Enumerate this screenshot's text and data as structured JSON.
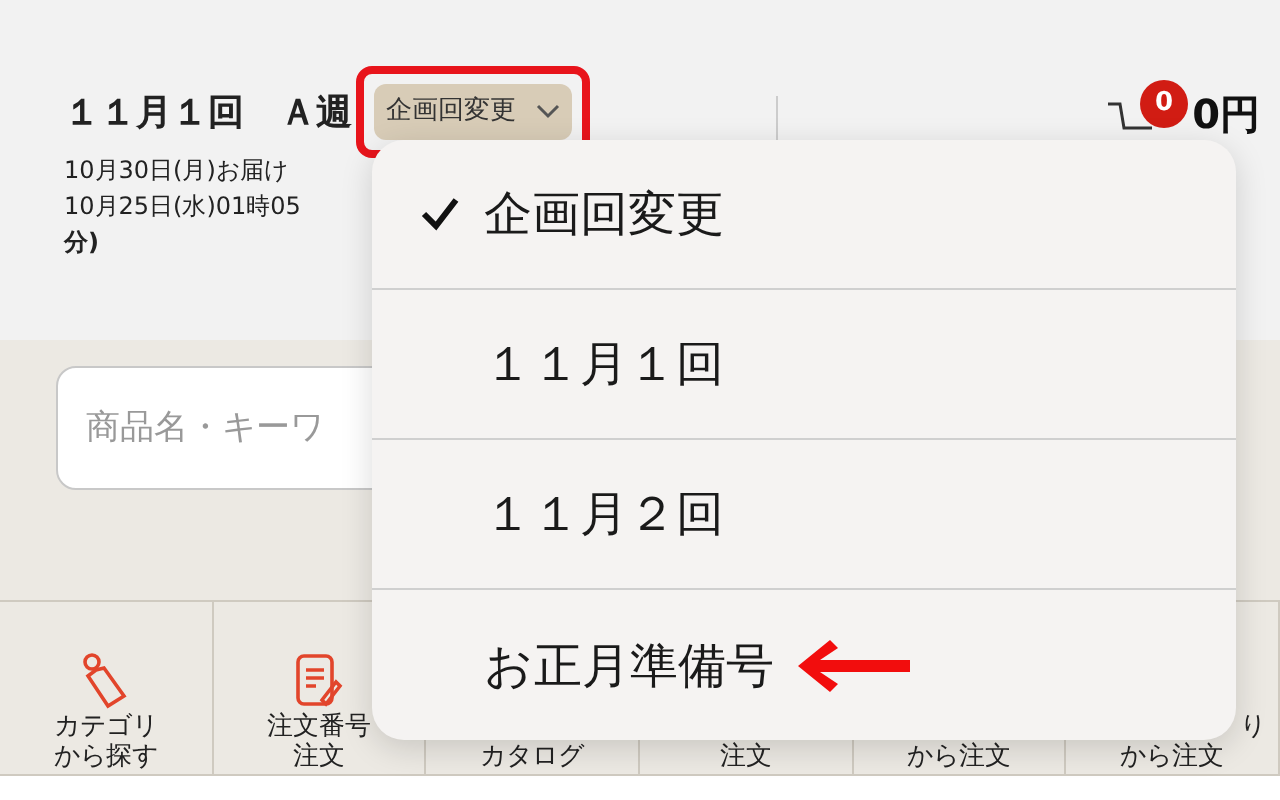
{
  "header": {
    "title": "１１月１回　Ａ週",
    "plan_button": {
      "label": "企画回変更",
      "highlighted": true
    },
    "delivery_lines": [
      "10月30日(月)お届け",
      "10月25日(水)01時05",
      "分)"
    ],
    "cart": {
      "badge": "0",
      "total": "0円"
    }
  },
  "search": {
    "placeholder": "商品名・キーワ"
  },
  "nav_tiles": [
    {
      "kind": "tag",
      "lines": [
        "カテゴリ",
        "から探す"
      ]
    },
    {
      "kind": "memo",
      "lines": [
        "注文番号",
        "注文"
      ]
    },
    {
      "kind": "blank",
      "lines": [
        "カタログ"
      ]
    },
    {
      "kind": "blank",
      "lines": [
        "注文"
      ]
    },
    {
      "kind": "blank",
      "lines": [
        "から注文"
      ]
    },
    {
      "kind": "blank",
      "lines": [
        "り",
        "から注文"
      ]
    }
  ],
  "menu": {
    "items": [
      {
        "label": "企画回変更",
        "selected": true,
        "pointer": false
      },
      {
        "label": "１１月１回",
        "selected": false,
        "pointer": false
      },
      {
        "label": "１１月２回",
        "selected": false,
        "pointer": false
      },
      {
        "label": "お正月準備号",
        "selected": false,
        "pointer": true
      }
    ]
  }
}
